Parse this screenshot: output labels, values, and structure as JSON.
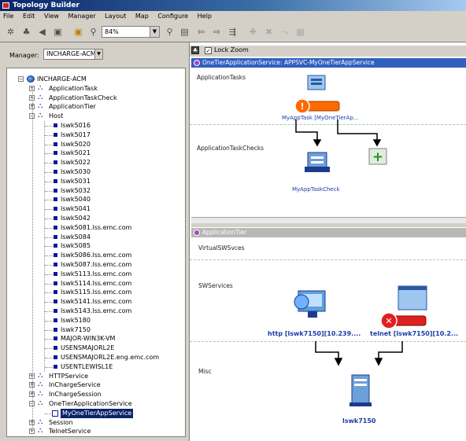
{
  "window": {
    "title": "Topology Builder"
  },
  "menu": [
    "File",
    "Edit",
    "View",
    "Manager",
    "Layout",
    "Map",
    "Configure",
    "Help"
  ],
  "toolbar": {
    "zoom": "84%"
  },
  "manager": {
    "label": "Manager:",
    "value": "INCHARGE-ACM"
  },
  "tree": {
    "root": "INCHARGE-ACM",
    "classes_top": [
      "ApplicationTask",
      "ApplicationTaskCheck",
      "ApplicationTier"
    ],
    "host_label": "Host",
    "hosts": [
      "lswk5016",
      "lswk5017",
      "lswk5020",
      "lswk5021",
      "lswk5022",
      "lswk5030",
      "lswk5031",
      "lswk5032",
      "lswk5040",
      "lswk5041",
      "lswk5042",
      "lswk5081.lss.emc.com",
      "lswk5084",
      "lswk5085",
      "lswk5086.lss.emc.com",
      "lswk5087.lss.emc.com",
      "lswk5113.lss.emc.com",
      "lswk5114.lss.emc.com",
      "lswk5115.lss.emc.com",
      "lswk5141.lss.emc.com",
      "lswk5143.lss.emc.com",
      "lswk5180",
      "lswk7150",
      "MAJOR-WIN3K-VM",
      "USENSMAJORL2E",
      "USENSMAJORL2E.eng.emc.com",
      "USENTLEWISL1E"
    ],
    "classes_mid": [
      "HTTPService",
      "InChargeService",
      "InChargeSession"
    ],
    "onetier_label": "OneTierApplicationService",
    "onetier_child": "MyOneTierAppService",
    "classes_bottom": [
      "Session",
      "TelnetService"
    ]
  },
  "view": {
    "lock_zoom": "Lock Zoom",
    "top_header": "OneTierApplicationService: APPSVC-MyOneTierAppService",
    "app_tasks_label": "ApplicationTasks",
    "app_task_checks_label": "ApplicationTaskChecks",
    "task_node": "MyAppTask [MyOneTierAp...",
    "check_node": "MyAppTaskCheck",
    "bottom_header": "ApplicationTier",
    "virtual_label": "VirtualSWSvces",
    "sw_label": "SWServices",
    "misc_label": "Misc",
    "http_node": "http [lswk7150][10.239....",
    "telnet_node": "telnet [lswk7150][10.2...",
    "host_node": "lswk7150"
  },
  "colors": {
    "header": "#3060c0",
    "status_orange": "#ff6a00",
    "status_red": "#e02020",
    "add_green": "#1a9a1a"
  }
}
